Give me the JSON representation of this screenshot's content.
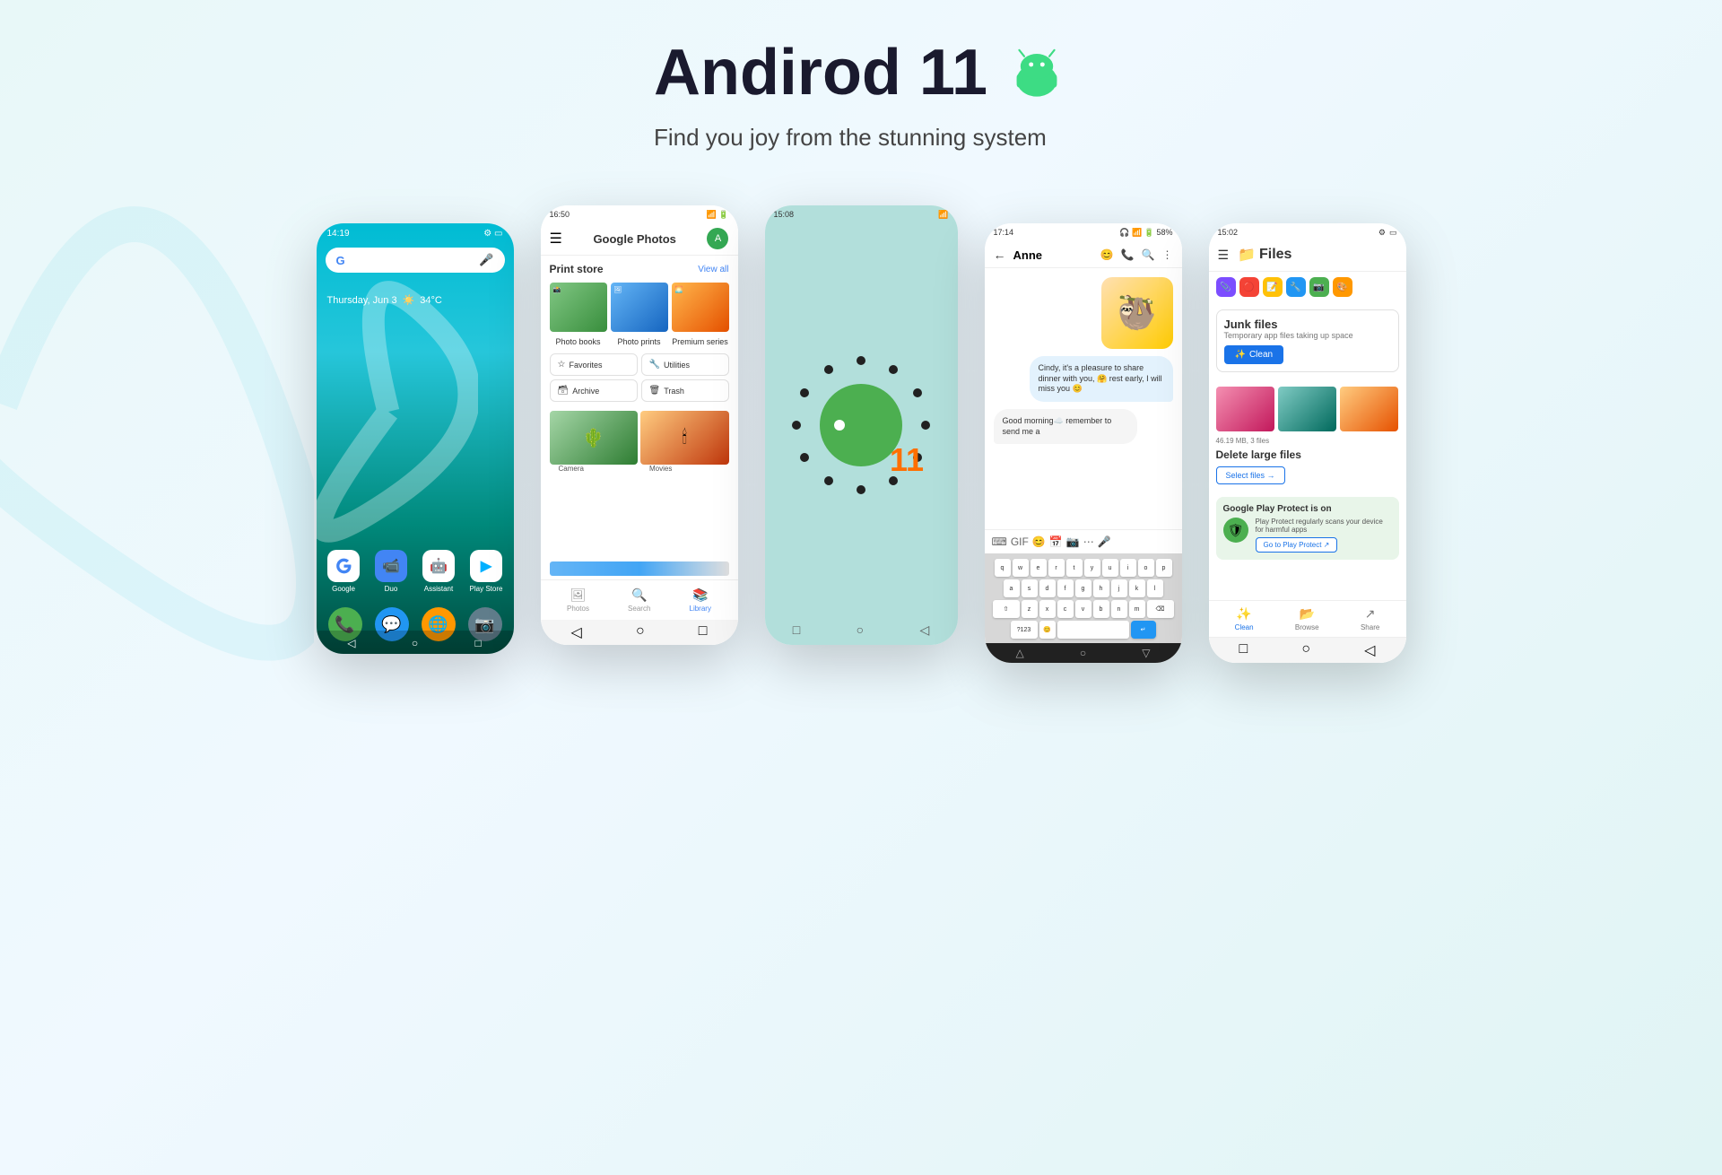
{
  "hero": {
    "title": "Andirod 11",
    "subtitle": "Find you joy from the stunning system"
  },
  "phone1": {
    "status_time": "14:19",
    "date": "Thursday, Jun 3",
    "temp": "34°C",
    "apps": [
      {
        "label": "Google",
        "color": "#fff",
        "bg": "#fff",
        "icon": "G"
      },
      {
        "label": "Duo",
        "color": "#fff",
        "bg": "#4285f4",
        "icon": "📹"
      },
      {
        "label": "Assistant",
        "color": "#fff",
        "bg": "#fff",
        "icon": "🤖"
      },
      {
        "label": "Play Store",
        "color": "#fff",
        "bg": "#fff",
        "icon": "▶"
      }
    ],
    "dock": [
      {
        "icon": "📞",
        "bg": "#4caf50"
      },
      {
        "icon": "💬",
        "bg": "#2196f3"
      },
      {
        "icon": "🌐",
        "bg": "#ff9800"
      },
      {
        "icon": "📷",
        "bg": "#9e9e9e"
      }
    ]
  },
  "phone2": {
    "status_time": "16:50",
    "app_name": "Google Photos",
    "store_title": "Print store",
    "view_all": "View all",
    "categories": [
      "Photo books",
      "Photo prints",
      "Premium series"
    ],
    "buttons": [
      {
        "icon": "☆",
        "label": "Favorites"
      },
      {
        "icon": "🔧",
        "label": "Utilities"
      },
      {
        "icon": "🗃",
        "label": "Archive"
      },
      {
        "icon": "🗑",
        "label": "Trash"
      }
    ],
    "gallery_labels": [
      "Camera",
      "Movies"
    ],
    "nav_items": [
      "Photos",
      "Search",
      "Library"
    ]
  },
  "phone3": {
    "status_time": "15:08",
    "number": "11"
  },
  "phone4": {
    "status_time": "17:14",
    "contact": "Anne",
    "messages": [
      {
        "type": "sticker",
        "emoji": "🦥"
      },
      {
        "type": "right",
        "text": "Cindy, it's a pleasure to share dinner with you, 🤗 rest early, I will miss you 😊"
      },
      {
        "type": "left",
        "text": "Good morning☁️ remember to send me a"
      }
    ],
    "keyboard_rows": [
      [
        "q",
        "w",
        "e",
        "r",
        "t",
        "y",
        "u",
        "i",
        "o",
        "p"
      ],
      [
        "a",
        "s",
        "d",
        "f",
        "g",
        "h",
        "j",
        "k",
        "l"
      ],
      [
        "z",
        "x",
        "c",
        "v",
        "b",
        "n",
        "m"
      ]
    ]
  },
  "phone5": {
    "status_time": "15:02",
    "app_name": "Files",
    "junk": {
      "title": "Junk files",
      "subtitle": "Temporary app files taking up space",
      "clean_btn": "Clean"
    },
    "large_files": {
      "meta": "46.19 MB, 3 files",
      "title": "Delete large files",
      "select_btn": "Select files →"
    },
    "play_protect": {
      "header": "Google Play Protect is on",
      "text": "Play Protect regularly scans your device for harmful apps",
      "btn": "Go to Play Protect ↗"
    },
    "nav": [
      "Clean",
      "Browse",
      "Share"
    ]
  }
}
